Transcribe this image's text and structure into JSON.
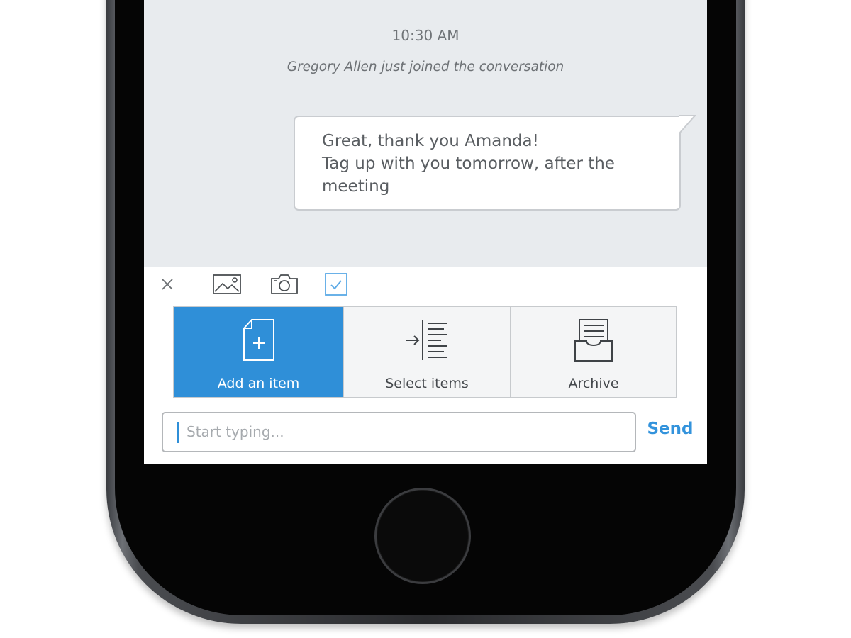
{
  "conversation": {
    "timestamp": "10:30 AM",
    "system_message": "Gregory Allen just joined the conversation",
    "messages": [
      {
        "lines": [
          "Great, thank you Amanda!",
          "Tag up with you tomorrow, after the",
          "meeting"
        ]
      }
    ]
  },
  "toolbar": {
    "icons": [
      "close-icon",
      "image-icon",
      "camera-icon",
      "checkbox-icon"
    ],
    "active_icon": "checkbox-icon"
  },
  "actions": [
    {
      "label": "Add an item",
      "icon": "add-document-icon",
      "selected": true
    },
    {
      "label": "Select items",
      "icon": "select-items-icon",
      "selected": false
    },
    {
      "label": "Archive",
      "icon": "archive-tray-icon",
      "selected": false
    }
  ],
  "composer": {
    "placeholder": "Start typing...",
    "value": "",
    "send_label": "Send"
  },
  "colors": {
    "accent": "#2f8fd8",
    "conversation_bg": "#e8ebee",
    "phone_body": "#2a2b2e"
  }
}
